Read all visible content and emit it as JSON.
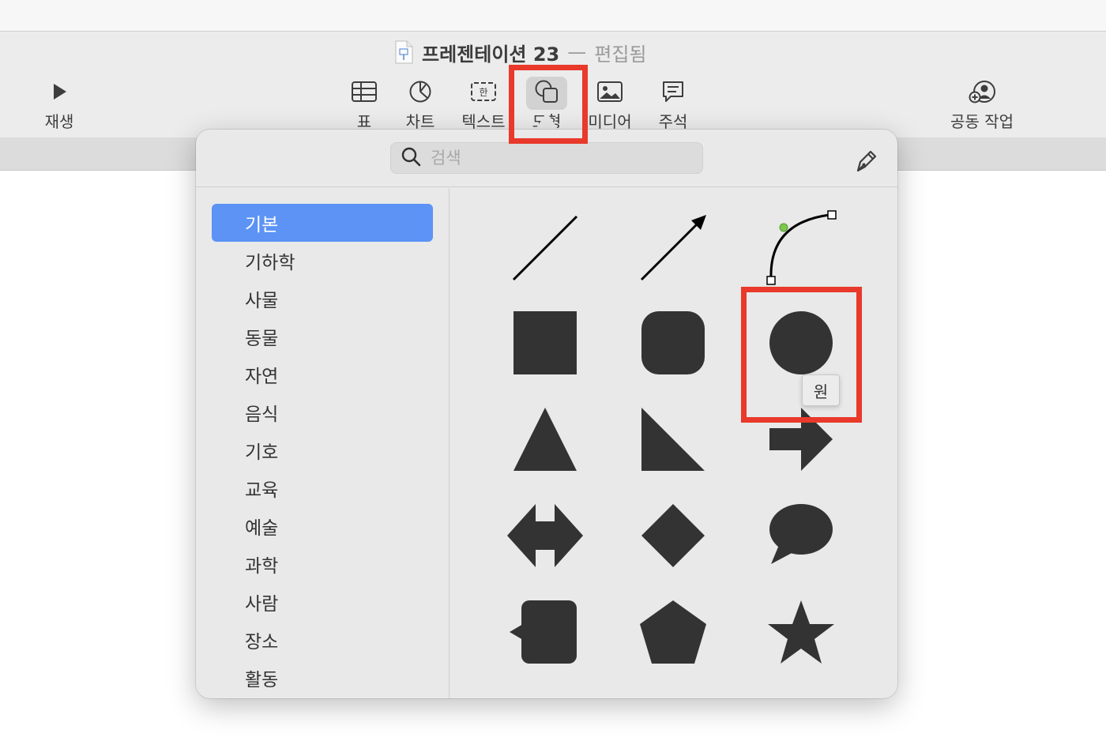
{
  "window": {
    "title": "프레젠테이션 23",
    "separator": "—",
    "status": "편집됨"
  },
  "toolbar": {
    "play_label": "재생",
    "table_label": "표",
    "chart_label": "차트",
    "text_label": "텍스트",
    "shape_label": "도형",
    "media_label": "미디어",
    "comment_label": "주석",
    "collaborate_label": "공동 작업"
  },
  "shape_library": {
    "search_placeholder": "검색",
    "categories": [
      {
        "label": "기본",
        "selected": true
      },
      {
        "label": "기하학"
      },
      {
        "label": "사물"
      },
      {
        "label": "동물"
      },
      {
        "label": "자연"
      },
      {
        "label": "음식"
      },
      {
        "label": "기호"
      },
      {
        "label": "교육"
      },
      {
        "label": "예술"
      },
      {
        "label": "과학"
      },
      {
        "label": "사람"
      },
      {
        "label": "장소"
      },
      {
        "label": "활동"
      }
    ],
    "tooltip": "원",
    "shape_fill": "#333333",
    "accent_color": "#5c93f5",
    "highlight_color": "#e8392b"
  }
}
